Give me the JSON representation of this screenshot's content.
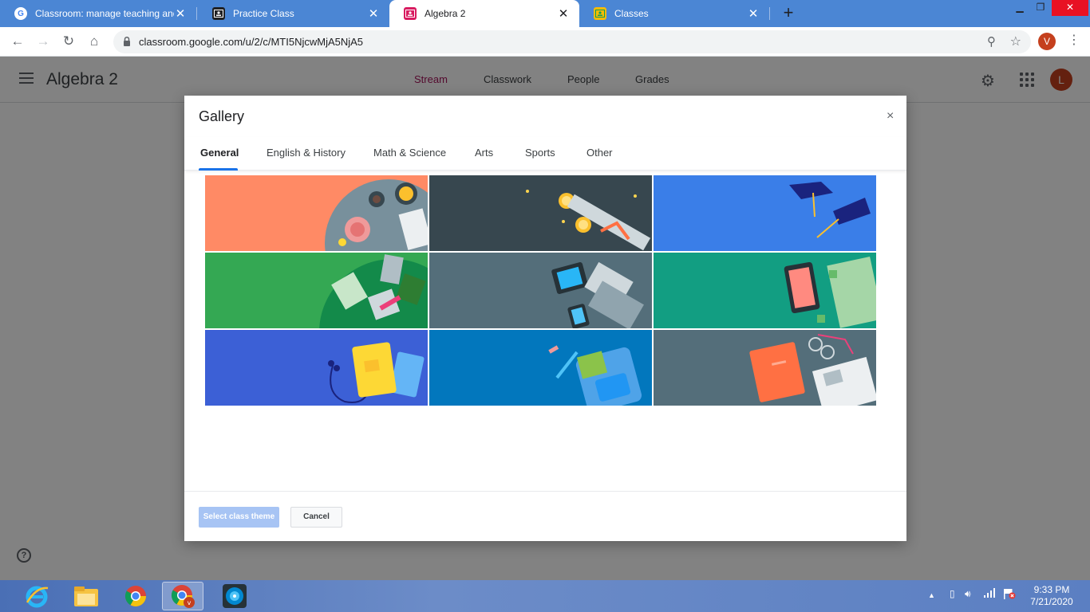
{
  "browser": {
    "tabs": [
      {
        "title": "Classroom: manage teaching and",
        "favicon": "google-g-icon",
        "active": false
      },
      {
        "title": "Practice Class",
        "favicon": "classroom-icon",
        "active": false
      },
      {
        "title": "Algebra 2",
        "favicon": "classroom-pink-icon",
        "active": true
      },
      {
        "title": "Classes",
        "favicon": "classroom-icon",
        "active": false
      }
    ],
    "close_glyph": "✕",
    "new_tab_glyph": "+",
    "url": "classroom.google.com/u/2/c/MTI5NjcwMjA5NjA5",
    "profile_initial": "V"
  },
  "classroom": {
    "class_name": "Algebra 2",
    "nav_tabs": [
      "Stream",
      "Classwork",
      "People",
      "Grades"
    ],
    "active_tab": "Stream",
    "user_initial": "L",
    "help_glyph": "?"
  },
  "gallery": {
    "title": "Gallery",
    "close_glyph": "×",
    "categories": [
      "General",
      "English & History",
      "Math & Science",
      "Arts",
      "Sports",
      "Other"
    ],
    "active_category": "General",
    "themes": [
      {
        "name": "coffee-desk-theme",
        "bg": "#ff8a65"
      },
      {
        "name": "diploma-theme",
        "bg": "#37474f"
      },
      {
        "name": "graduation-caps-theme",
        "bg": "#3a7ee8"
      },
      {
        "name": "notebooks-theme",
        "bg": "#34a853"
      },
      {
        "name": "laptop-theme",
        "bg": "#546e7a"
      },
      {
        "name": "phone-charts-theme",
        "bg": "#129e82"
      },
      {
        "name": "book-headphones-theme",
        "bg": "#3c60d6"
      },
      {
        "name": "backpack-theme",
        "bg": "#0277bd"
      },
      {
        "name": "newspaper-book-theme",
        "bg": "#546e7a"
      }
    ],
    "select_label": "Select class theme",
    "cancel_label": "Cancel"
  },
  "taskbar": {
    "time": "9:33 PM",
    "date": "7/21/2020"
  },
  "colors": {
    "accent": "#1a73e8",
    "classroom_active": "#a5145a",
    "avatar": "#c5401e"
  }
}
